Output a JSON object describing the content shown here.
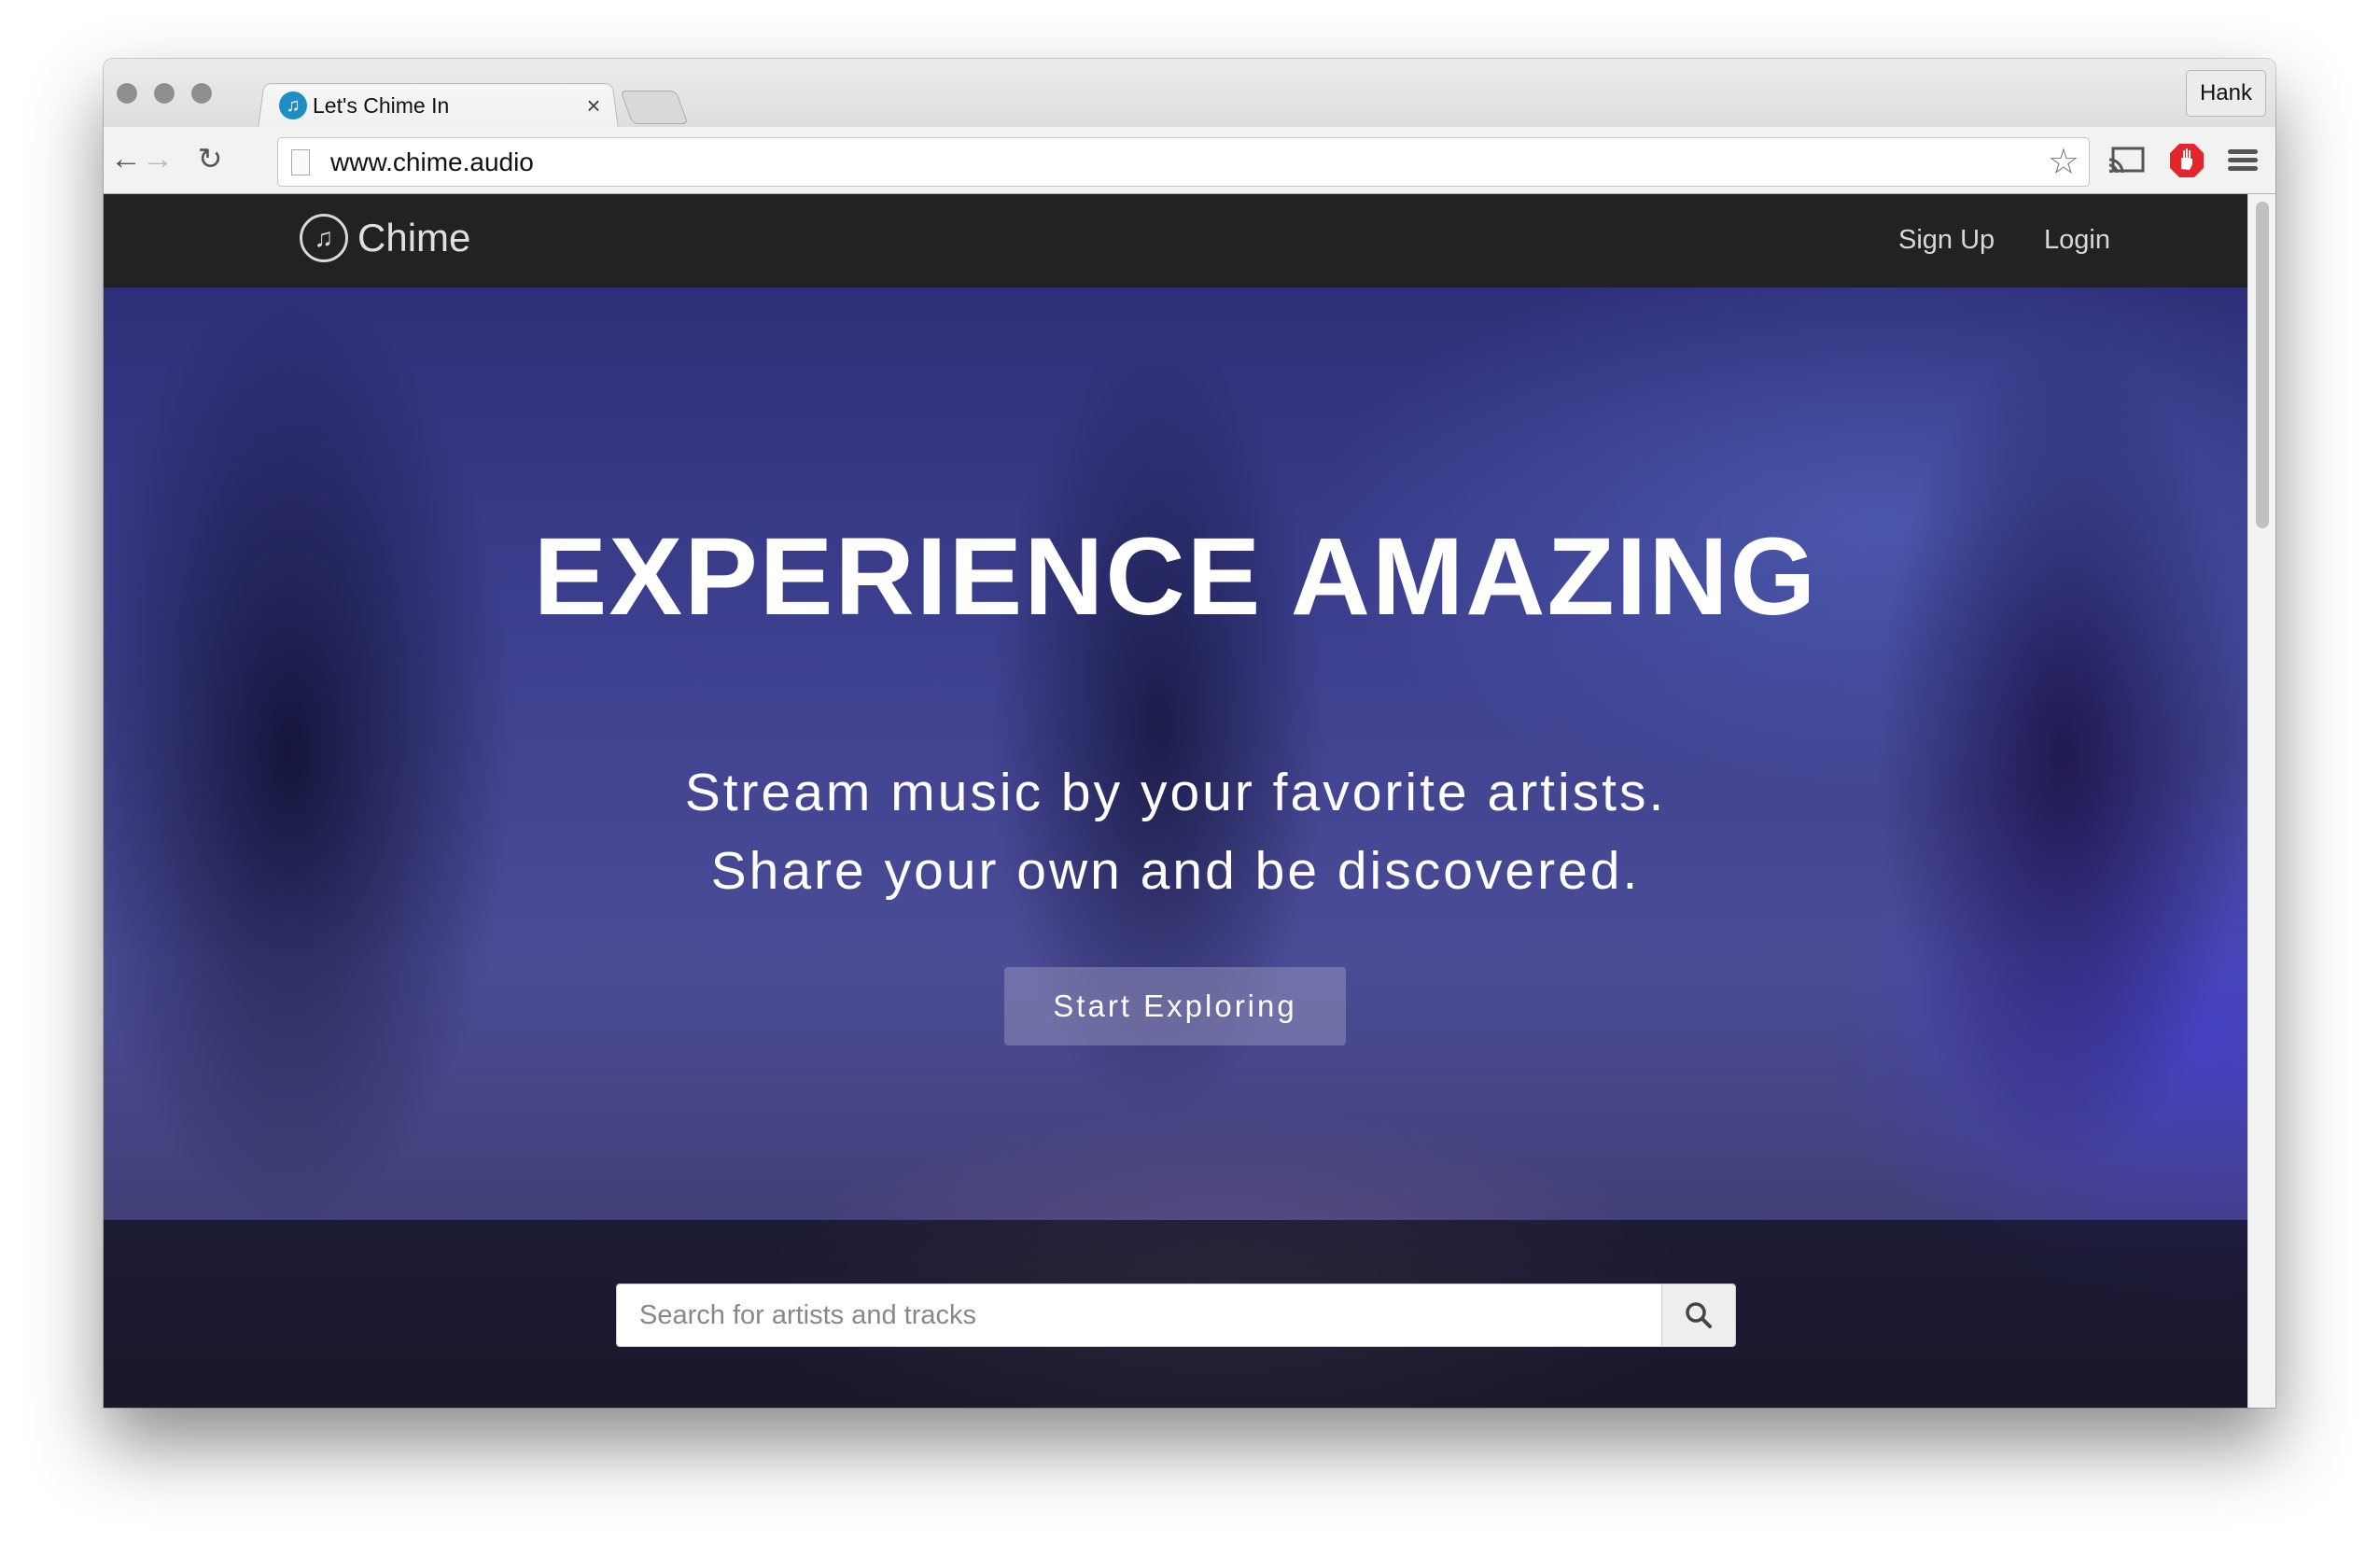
{
  "browser": {
    "tab_title": "Let's Chime In",
    "tab_close": "×",
    "profile_name": "Hank",
    "url": "www.chime.audio",
    "icons": [
      "back-arrow-icon",
      "forward-arrow-icon",
      "reload-icon",
      "page-icon",
      "bookmark-star-icon",
      "cast-icon",
      "adblock-icon",
      "menu-icon"
    ]
  },
  "nav": {
    "brand": "Chime",
    "links": [
      {
        "label": "Sign Up"
      },
      {
        "label": "Login"
      }
    ]
  },
  "hero": {
    "headline": "EXPERIENCE AMAZING",
    "subline_1": "Stream music by your favorite artists.",
    "subline_2": "Share your own and be discovered.",
    "cta_label": "Start Exploring"
  },
  "search": {
    "placeholder": "Search for artists and tracks",
    "value": ""
  },
  "colors": {
    "nav_bg": "#222222",
    "adblock_red": "#e2262b",
    "favicon_blue": "#1e8fc4"
  }
}
